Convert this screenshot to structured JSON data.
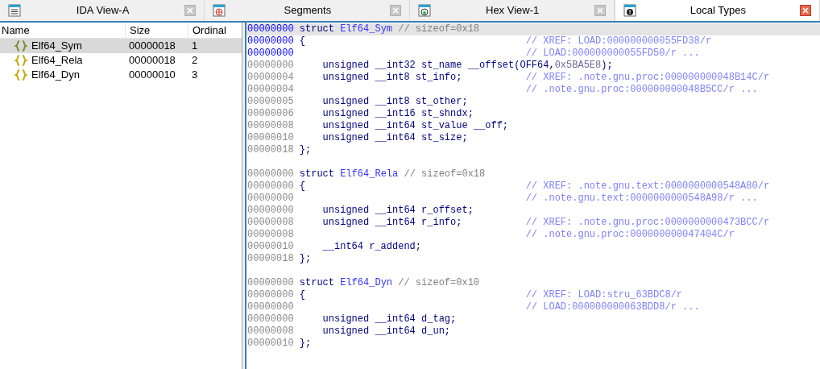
{
  "tabs": [
    {
      "label": "IDA View-A",
      "selected": false
    },
    {
      "label": "Segments",
      "selected": false
    },
    {
      "label": "Hex View-1",
      "selected": false
    },
    {
      "label": "Local Types",
      "selected": true
    }
  ],
  "types_list": {
    "columns": [
      "Name",
      "Size",
      "Ordinal"
    ],
    "rows": [
      {
        "name": "Elf64_Sym",
        "size": "00000018",
        "ordinal": "1",
        "selected": true
      },
      {
        "name": "Elf64_Rela",
        "size": "00000018",
        "ordinal": "2",
        "selected": false
      },
      {
        "name": "Elf64_Dyn",
        "size": "00000010",
        "ordinal": "3",
        "selected": false
      }
    ]
  },
  "listing": [
    {
      "kind": "declaration",
      "address": "00000000",
      "current": true,
      "code": [
        {
          "kind": "keyword",
          "text": "struct "
        },
        {
          "kind": "name",
          "text": "Elf64_Sym"
        },
        {
          "kind": "comment",
          "text": " // sizeof=0x18"
        }
      ]
    },
    {
      "kind": "declaration",
      "address": "00000000",
      "current": false,
      "code": [
        {
          "kind": "keyword",
          "text": "{"
        }
      ],
      "comment": "// XREF: LOAD:000000000055FD38/r"
    },
    {
      "kind": "declaration",
      "address": "00000000",
      "current": false,
      "comment": "// LOAD:000000000055FD50/r ..."
    },
    {
      "kind": "member",
      "address": "00000000",
      "current": false,
      "code": [
        {
          "kind": "code",
          "text": "    unsigned __int32 st_name __offset(OFF64,"
        },
        {
          "kind": "number",
          "text": "0x5BA5E8"
        },
        {
          "kind": "code",
          "text": ");"
        }
      ]
    },
    {
      "kind": "member",
      "address": "00000004",
      "current": false,
      "code": [
        {
          "kind": "code",
          "text": "    unsigned __int8 st_info;"
        }
      ],
      "comment": "// XREF: .note.gnu.proc:000000000048B14C/r"
    },
    {
      "kind": "member",
      "address": "00000004",
      "current": false,
      "comment": "// .note.gnu.proc:000000000048B5CC/r ..."
    },
    {
      "kind": "member",
      "address": "00000005",
      "current": false,
      "code": [
        {
          "kind": "code",
          "text": "    unsigned __int8 st_other;"
        }
      ]
    },
    {
      "kind": "member",
      "address": "00000006",
      "current": false,
      "code": [
        {
          "kind": "code",
          "text": "    unsigned __int16 st_shndx;"
        }
      ]
    },
    {
      "kind": "member",
      "address": "00000008",
      "current": false,
      "code": [
        {
          "kind": "code",
          "text": "    unsigned __int64 st_value __off;"
        }
      ]
    },
    {
      "kind": "member",
      "address": "00000010",
      "current": false,
      "code": [
        {
          "kind": "code",
          "text": "    unsigned __int64 st_size;"
        }
      ]
    },
    {
      "kind": "member",
      "address": "00000018",
      "current": false,
      "code": [
        {
          "kind": "keyword",
          "text": "};"
        }
      ]
    },
    {
      "kind": "blank"
    },
    {
      "kind": "member",
      "address": "00000000",
      "current": false,
      "code": [
        {
          "kind": "keyword",
          "text": "struct "
        },
        {
          "kind": "name",
          "text": "Elf64_Rela"
        },
        {
          "kind": "comment",
          "text": " // sizeof=0x18"
        }
      ]
    },
    {
      "kind": "member",
      "address": "00000000",
      "current": false,
      "code": [
        {
          "kind": "keyword",
          "text": "{"
        }
      ],
      "comment": "// XREF: .note.gnu.text:0000000000548A80/r"
    },
    {
      "kind": "member",
      "address": "00000000",
      "current": false,
      "comment": "// .note.gnu.text:0000000000548A98/r ..."
    },
    {
      "kind": "member",
      "address": "00000000",
      "current": false,
      "code": [
        {
          "kind": "code",
          "text": "    unsigned __int64 r_offset;"
        }
      ]
    },
    {
      "kind": "member",
      "address": "00000008",
      "current": false,
      "code": [
        {
          "kind": "code",
          "text": "    unsigned __int64 r_info;"
        }
      ],
      "comment": "// XREF: .note.gnu.proc:0000000000473BCC/r"
    },
    {
      "kind": "member",
      "address": "00000008",
      "current": false,
      "comment": "// .note.gnu.proc:000000000047404C/r"
    },
    {
      "kind": "member",
      "address": "00000010",
      "current": false,
      "code": [
        {
          "kind": "code",
          "text": "    __int64 r_addend;"
        }
      ]
    },
    {
      "kind": "member",
      "address": "00000018",
      "current": false,
      "code": [
        {
          "kind": "keyword",
          "text": "};"
        }
      ]
    },
    {
      "kind": "blank"
    },
    {
      "kind": "member",
      "address": "00000000",
      "current": false,
      "code": [
        {
          "kind": "keyword",
          "text": "struct "
        },
        {
          "kind": "name",
          "text": "Elf64_Dyn"
        },
        {
          "kind": "comment",
          "text": " // sizeof=0x10"
        }
      ]
    },
    {
      "kind": "member",
      "address": "00000000",
      "current": false,
      "code": [
        {
          "kind": "keyword",
          "text": "{"
        }
      ],
      "comment": "// XREF: LOAD:stru_63BDC8/r"
    },
    {
      "kind": "member",
      "address": "00000000",
      "current": false,
      "comment": "// LOAD:000000000063BDD8/r ..."
    },
    {
      "kind": "member",
      "address": "00000000",
      "current": false,
      "code": [
        {
          "kind": "code",
          "text": "    unsigned __int64 d_tag;"
        }
      ]
    },
    {
      "kind": "member",
      "address": "00000008",
      "current": false,
      "code": [
        {
          "kind": "code",
          "text": "    unsigned __int64 d_un;"
        }
      ]
    },
    {
      "kind": "member",
      "address": "00000010",
      "current": false,
      "code": [
        {
          "kind": "keyword",
          "text": "};"
        }
      ]
    }
  ]
}
